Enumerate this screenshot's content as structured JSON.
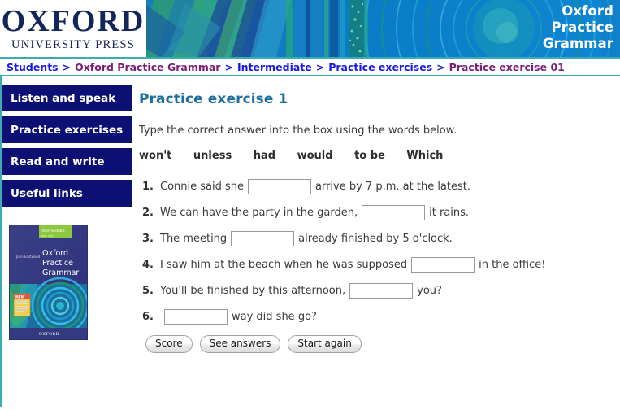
{
  "header": {
    "publisher_line1": "OXFORD",
    "publisher_line2": "UNIVERSITY PRESS",
    "title_line1": "Oxford",
    "title_line2": "Practice",
    "title_line3": "Grammar"
  },
  "breadcrumb": {
    "separator": ">",
    "items": [
      {
        "label": "Students",
        "state": "blue"
      },
      {
        "label": "Oxford Practice Grammar",
        "state": "purple"
      },
      {
        "label": "Intermediate",
        "state": "blue"
      },
      {
        "label": "Practice exercises",
        "state": "blue"
      },
      {
        "label": "Practice exercise 01",
        "state": "purple"
      }
    ]
  },
  "sidebar": {
    "items": [
      {
        "label": "Listen and speak"
      },
      {
        "label": "Practice exercises"
      },
      {
        "label": "Read and write"
      },
      {
        "label": "Useful links"
      }
    ],
    "book_cover": {
      "author": "John Eastwood",
      "title_line1": "Oxford",
      "title_line2": "Practice",
      "title_line3": "Grammar",
      "level": "Intermediate",
      "subtitle": "with key",
      "badge": "NEW",
      "imprint": "OXFORD"
    }
  },
  "main": {
    "title": "Practice exercise 1",
    "instruction": "Type the correct answer into the box using the words below.",
    "wordbank": [
      "won't",
      "unless",
      "had",
      "would",
      "to be",
      "Which"
    ],
    "questions": [
      {
        "num": "1.",
        "before": "Connie said she",
        "value": "",
        "after": "arrive by 7 p.m. at the latest."
      },
      {
        "num": "2.",
        "before": "We can have the party in the garden,",
        "value": "",
        "after": "it rains."
      },
      {
        "num": "3.",
        "before": "The meeting",
        "value": "",
        "after": "already finished by 5 o'clock."
      },
      {
        "num": "4.",
        "before": "I saw him at the beach when he was supposed",
        "value": "",
        "after": "in the office!"
      },
      {
        "num": "5.",
        "before": "You'll be finished by this afternoon,",
        "value": "",
        "after": "you?"
      },
      {
        "num": "6.",
        "before": "",
        "value": "",
        "after": "way did she go?"
      }
    ],
    "buttons": [
      {
        "label": "Score"
      },
      {
        "label": "See answers"
      },
      {
        "label": "Start again"
      }
    ]
  },
  "colors": {
    "nav_navy": "#0d1073",
    "accent_teal": "#3cabb4",
    "heading_blue": "#1d6ea0",
    "link_blue": "#1a1ae0",
    "link_visited": "#7a1f7a",
    "banner_blue": "#0b78c4"
  }
}
